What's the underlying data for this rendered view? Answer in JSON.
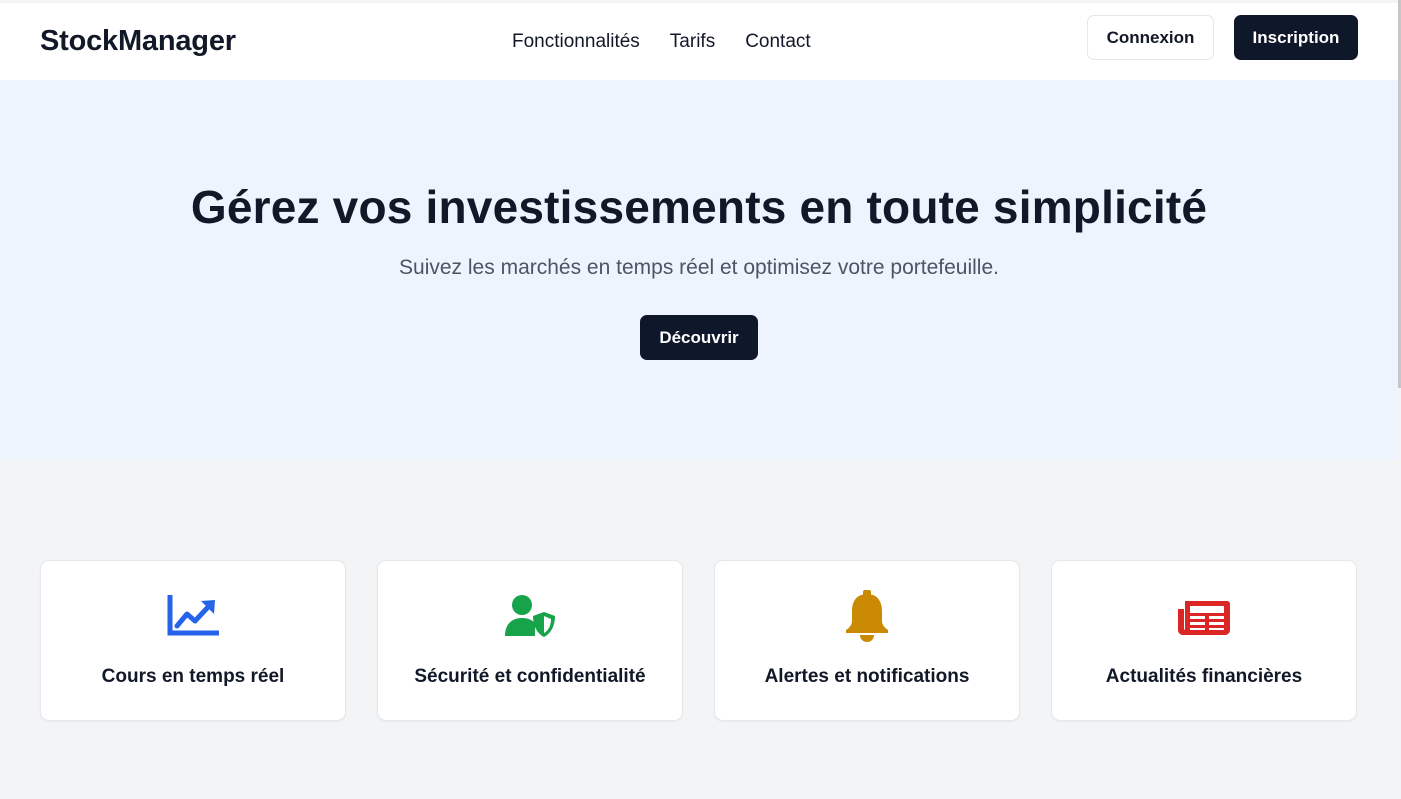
{
  "header": {
    "brand": "StockManager",
    "nav": [
      "Fonctionnalités",
      "Tarifs",
      "Contact"
    ],
    "login_label": "Connexion",
    "signup_label": "Inscription"
  },
  "hero": {
    "title": "Gérez vos investissements en toute simplicité",
    "subtitle": "Suivez les marchés en temps réel et optimisez votre portefeuille.",
    "cta_label": "Découvrir"
  },
  "features": [
    {
      "label": "Cours en temps réel",
      "icon": "chart-line-icon",
      "color": "#2563eb"
    },
    {
      "label": "Sécurité et confidentialité",
      "icon": "user-shield-icon",
      "color": "#16a34a"
    },
    {
      "label": "Alertes et notifications",
      "icon": "bell-icon",
      "color": "#ca8a04"
    },
    {
      "label": "Actualités financières",
      "icon": "newspaper-icon",
      "color": "#dc2626"
    }
  ],
  "colors": {
    "primary_dark": "#0f172a",
    "hero_bg": "#eef4fe",
    "page_bg": "#f3f4f6"
  }
}
